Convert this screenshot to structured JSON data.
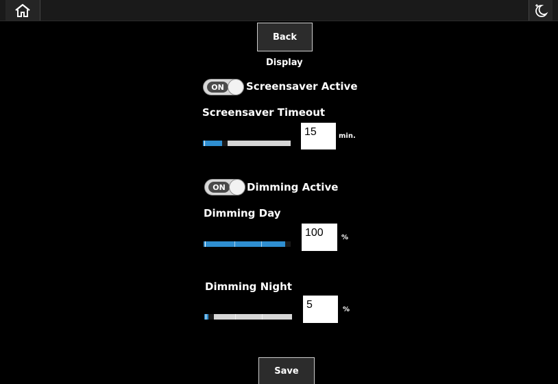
{
  "topbar": {
    "home_icon": "home-icon",
    "night_icon": "night-mode-icon"
  },
  "back_label": "Back",
  "section_title": "Display",
  "screensaver": {
    "toggle_state": "ON",
    "label": "Screensaver Active",
    "timeout_label": "Screensaver Timeout",
    "timeout_value": "15",
    "timeout_unit": "min."
  },
  "dimming": {
    "toggle_state": "ON",
    "label": "Dimming Active",
    "day_label": "Dimming Day",
    "day_value": "100",
    "day_unit": "%",
    "night_label": "Dimming Night",
    "night_value": "5",
    "night_unit": "%"
  },
  "save_label": "Save",
  "colors": {
    "accent": "#2f8fd1",
    "background": "#000000",
    "track": "#d6d6d6"
  }
}
